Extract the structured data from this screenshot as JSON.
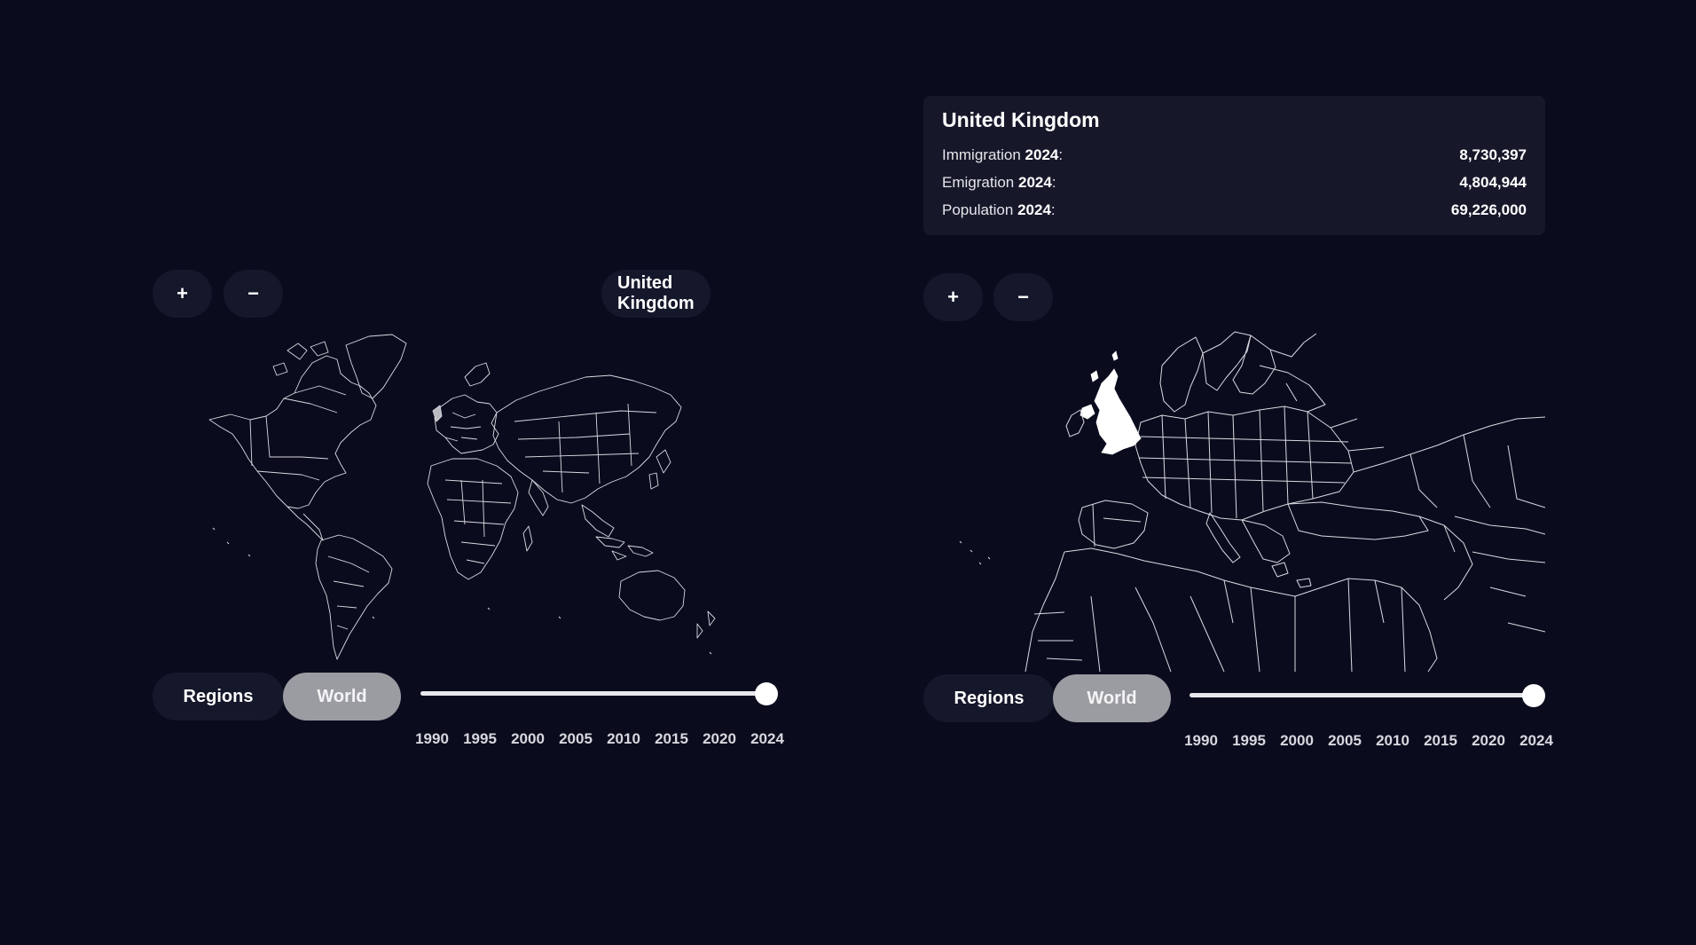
{
  "left_panel": {
    "zoom_in": "+",
    "zoom_out": "−",
    "selected_country": "United Kingdom",
    "mode_regions": "Regions",
    "mode_world": "World",
    "years": [
      "1990",
      "1995",
      "2000",
      "2005",
      "2010",
      "2015",
      "2020",
      "2024"
    ],
    "selected_year": "2024"
  },
  "right_panel": {
    "zoom_in": "+",
    "zoom_out": "−",
    "mode_regions": "Regions",
    "mode_world": "World",
    "years": [
      "1990",
      "1995",
      "2000",
      "2005",
      "2010",
      "2015",
      "2020",
      "2024"
    ],
    "selected_year": "2024"
  },
  "info_card": {
    "title": "United Kingdom",
    "rows": [
      {
        "label": "Immigration",
        "year": "2024",
        "colon": ":",
        "value": "8,730,397"
      },
      {
        "label": "Emigration",
        "year": "2024",
        "colon": ":",
        "value": "4,804,944"
      },
      {
        "label": "Population",
        "year": "2024",
        "colon": ":",
        "value": "69,226,000"
      }
    ]
  },
  "colors": {
    "background": "#0a0c1e",
    "pill": "#15172a",
    "active_pill": "#9b9ca1",
    "map_stroke": "#d9dae0",
    "highlight": "#ffffff"
  }
}
